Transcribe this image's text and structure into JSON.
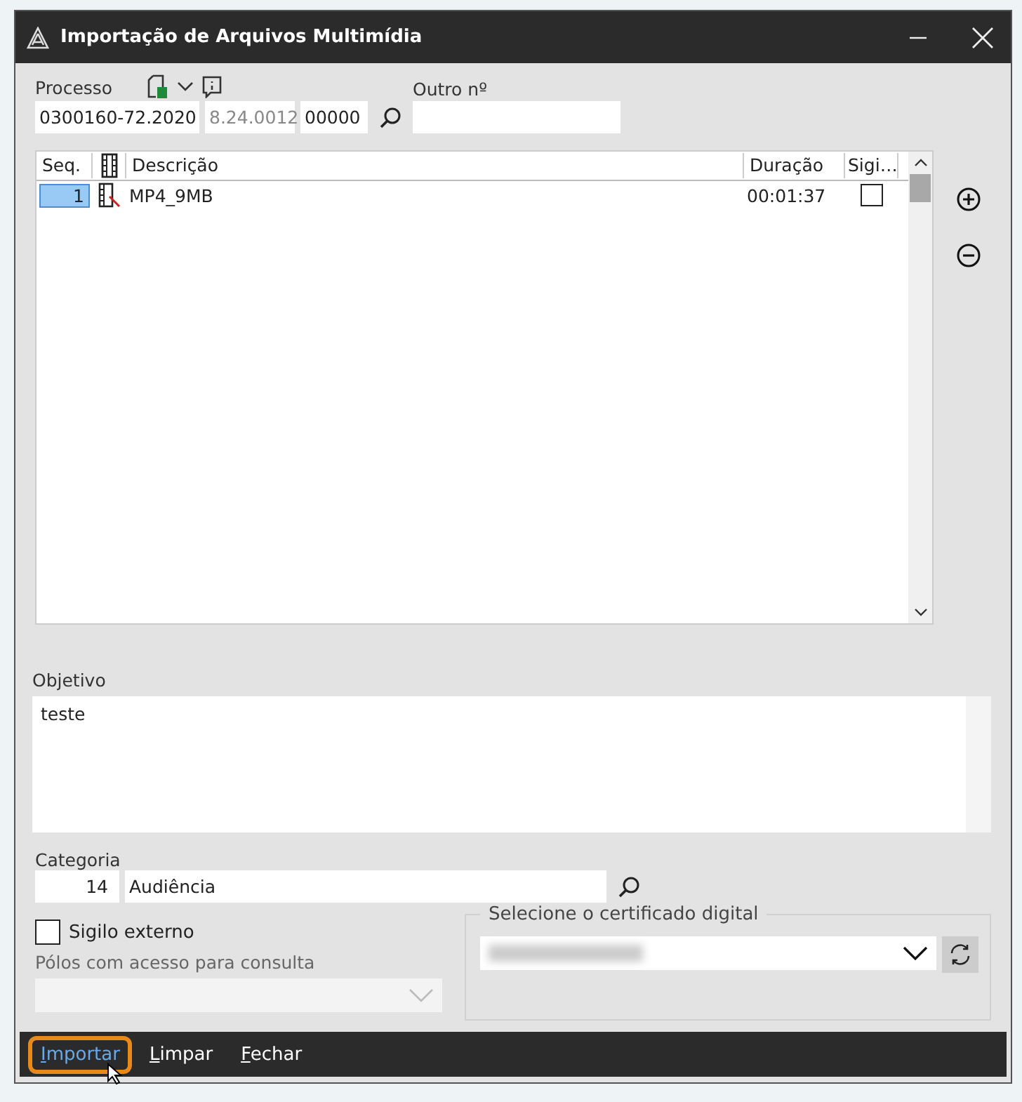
{
  "window": {
    "title": "Importação de Arquivos Multimídia"
  },
  "processo": {
    "label": "Processo",
    "number": "0300160-72.2020",
    "court": "8.24.0012",
    "suffix": "00000"
  },
  "outro": {
    "label": "Outro nº"
  },
  "table": {
    "columns": [
      "Seq.",
      "Descrição",
      "Duração",
      "Sigi…"
    ],
    "rows": [
      {
        "seq": "1",
        "descricao": "MP4_9MB",
        "duracao": "00:01:37",
        "sigilo": false,
        "selected": true
      }
    ]
  },
  "objetivo": {
    "label": "Objetivo",
    "value": "teste"
  },
  "categoria": {
    "label": "Categoria",
    "code": "14",
    "name": "Audiência"
  },
  "sigilo_externo": {
    "label": "Sigilo externo",
    "checked": false
  },
  "polos": {
    "label": "Pólos com acesso para consulta"
  },
  "certificado": {
    "label": "Selecione o certificado digital"
  },
  "buttons": [
    {
      "label": "Importar",
      "focused": true
    },
    {
      "label": "Limpar",
      "focused": false
    },
    {
      "label": "Fechar",
      "focused": false
    }
  ]
}
